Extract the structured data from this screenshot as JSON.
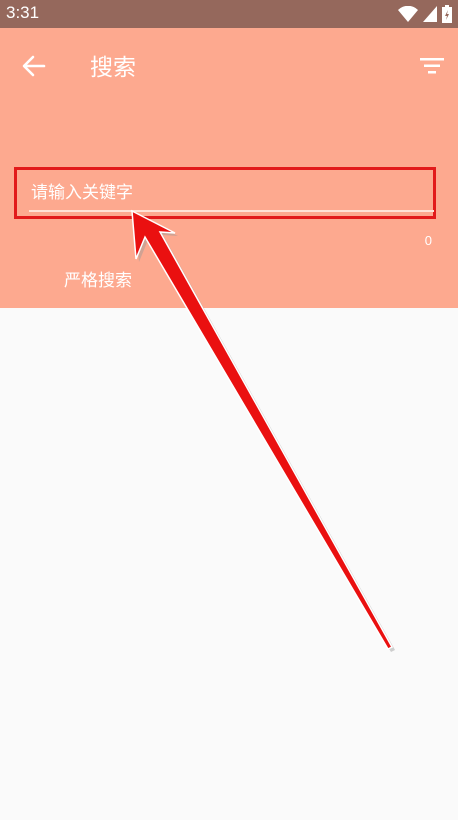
{
  "status_bar": {
    "time": "3:31"
  },
  "toolbar": {
    "title": "搜索"
  },
  "search": {
    "placeholder": "请输入关键字",
    "value": "",
    "char_count": "0"
  },
  "options": {
    "strict_search_label": "严格搜索"
  },
  "colors": {
    "header": "#fda98f",
    "status_bar": "#95685c",
    "highlight": "#e21a1a",
    "background": "#fafafa"
  },
  "icons": {
    "back": "back-arrow-icon",
    "filter": "filter-icon",
    "wifi": "wifi-icon",
    "signal": "signal-icon",
    "battery": "battery-icon"
  }
}
